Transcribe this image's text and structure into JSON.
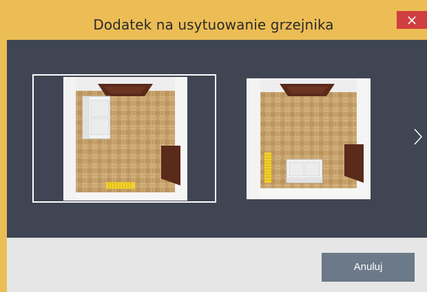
{
  "dialog": {
    "title": "Dodatek na usytuowanie grzejnika",
    "close_icon": "×",
    "cancel_label": "Anuluj"
  },
  "options": [
    {
      "name": "radiator-under-window-wall",
      "selected": true
    },
    {
      "name": "radiator-left-wall",
      "selected": false
    }
  ],
  "colors": {
    "titlebar": "#ecbd55",
    "content_bg": "#3f4553",
    "footer_bg": "#e6e6e6",
    "close_bg": "#cf3f3f",
    "cancel_bg": "#6b7989",
    "floor": "#c8a46e",
    "door": "#5a2a1a",
    "radiator": "#f2d22a"
  }
}
